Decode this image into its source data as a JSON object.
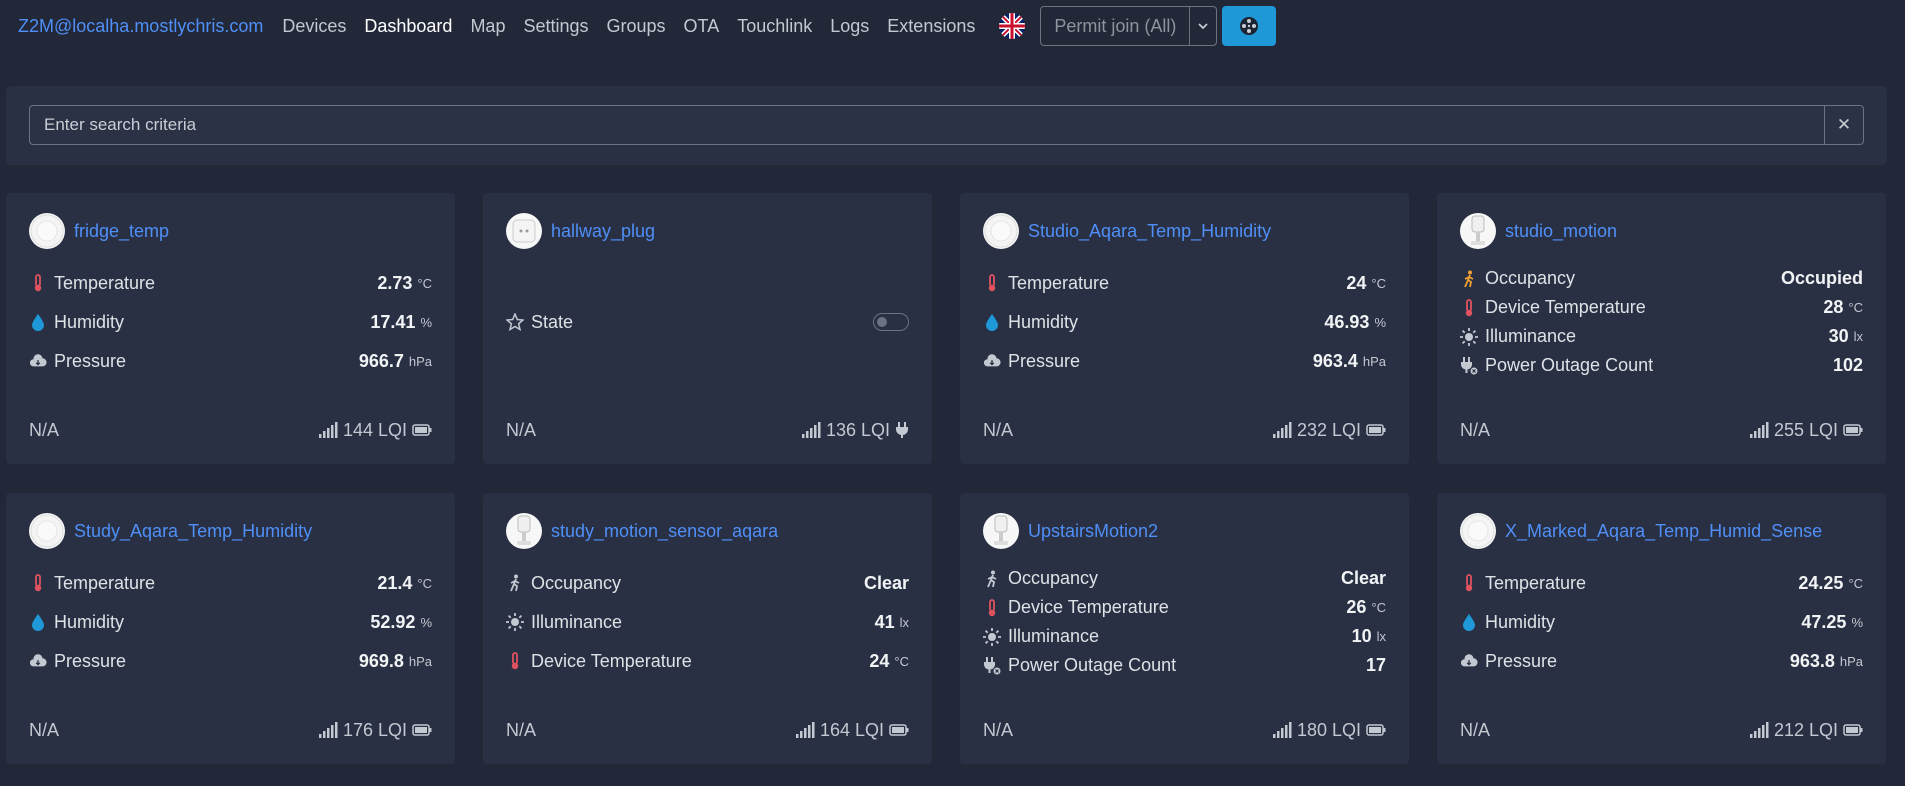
{
  "navbar": {
    "brand": "Z2M@localha.mostlychris.com",
    "links": [
      "Devices",
      "Dashboard",
      "Map",
      "Settings",
      "Groups",
      "OTA",
      "Touchlink",
      "Logs",
      "Extensions"
    ],
    "active": "Dashboard",
    "permit_join": "Permit join (All)"
  },
  "search": {
    "placeholder": "Enter search criteria",
    "clear": "✕"
  },
  "colors": {
    "accent": "#4f8ff7",
    "background": "#222838",
    "card": "#293043",
    "primary_button": "#1f98d8",
    "temperature_icon": "#e05260",
    "humidity_icon": "#1f98d8",
    "occupancy_icon": "#f0a030"
  },
  "devices": [
    {
      "name": "fridge_temp",
      "avatar": "round-sensor",
      "rows": [
        {
          "icon": "thermometer-icon",
          "label": "Temperature",
          "value": "2.73",
          "unit": "°C"
        },
        {
          "icon": "droplet-icon",
          "label": "Humidity",
          "value": "17.41",
          "unit": "%"
        },
        {
          "icon": "cloud-icon",
          "label": "Pressure",
          "value": "966.7",
          "unit": "hPa"
        }
      ],
      "footer": {
        "last_seen": "N/A",
        "lqi": "144 LQI",
        "power": "battery"
      }
    },
    {
      "name": "hallway_plug",
      "avatar": "plug",
      "rows": [
        {
          "icon": "star-icon",
          "label": "State",
          "value": "",
          "unit": "",
          "toggle": true
        }
      ],
      "footer": {
        "last_seen": "N/A",
        "lqi": "136 LQI",
        "power": "mains"
      }
    },
    {
      "name": "Studio_Aqara_Temp_Humidity",
      "avatar": "round-sensor",
      "rows": [
        {
          "icon": "thermometer-icon",
          "label": "Temperature",
          "value": "24",
          "unit": "°C"
        },
        {
          "icon": "droplet-icon",
          "label": "Humidity",
          "value": "46.93",
          "unit": "%"
        },
        {
          "icon": "cloud-icon",
          "label": "Pressure",
          "value": "963.4",
          "unit": "hPa"
        }
      ],
      "footer": {
        "last_seen": "N/A",
        "lqi": "232 LQI",
        "power": "battery"
      }
    },
    {
      "name": "studio_motion",
      "avatar": "motion-sensor",
      "rows": [
        {
          "icon": "walking-icon",
          "label": "Occupancy",
          "value": "Occupied",
          "unit": ""
        },
        {
          "icon": "thermometer-icon",
          "label": "Device Temperature",
          "value": "28",
          "unit": "°C"
        },
        {
          "icon": "sun-icon",
          "label": "Illuminance",
          "value": "30",
          "unit": "lx"
        },
        {
          "icon": "plug-off-icon",
          "label": "Power Outage Count",
          "value": "102",
          "unit": ""
        }
      ],
      "footer": {
        "last_seen": "N/A",
        "lqi": "255 LQI",
        "power": "battery"
      }
    },
    {
      "name": "Study_Aqara_Temp_Humidity",
      "avatar": "round-sensor",
      "rows": [
        {
          "icon": "thermometer-icon",
          "label": "Temperature",
          "value": "21.4",
          "unit": "°C"
        },
        {
          "icon": "droplet-icon",
          "label": "Humidity",
          "value": "52.92",
          "unit": "%"
        },
        {
          "icon": "cloud-icon",
          "label": "Pressure",
          "value": "969.8",
          "unit": "hPa"
        }
      ],
      "footer": {
        "last_seen": "N/A",
        "lqi": "176 LQI",
        "power": "battery"
      }
    },
    {
      "name": "study_motion_sensor_aqara",
      "avatar": "motion-sensor",
      "rows": [
        {
          "icon": "walking-icon",
          "label": "Occupancy",
          "value": "Clear",
          "unit": ""
        },
        {
          "icon": "sun-icon",
          "label": "Illuminance",
          "value": "41",
          "unit": "lx"
        },
        {
          "icon": "thermometer-icon",
          "label": "Device Temperature",
          "value": "24",
          "unit": "°C"
        }
      ],
      "footer": {
        "last_seen": "N/A",
        "lqi": "164 LQI",
        "power": "battery"
      }
    },
    {
      "name": "UpstairsMotion2",
      "avatar": "motion-sensor",
      "rows": [
        {
          "icon": "walking-icon",
          "label": "Occupancy",
          "value": "Clear",
          "unit": ""
        },
        {
          "icon": "thermometer-icon",
          "label": "Device Temperature",
          "value": "26",
          "unit": "°C"
        },
        {
          "icon": "sun-icon",
          "label": "Illuminance",
          "value": "10",
          "unit": "lx"
        },
        {
          "icon": "plug-off-icon",
          "label": "Power Outage Count",
          "value": "17",
          "unit": ""
        }
      ],
      "footer": {
        "last_seen": "N/A",
        "lqi": "180 LQI",
        "power": "battery"
      }
    },
    {
      "name": "X_Marked_Aqara_Temp_Humid_Sense",
      "avatar": "round-sensor",
      "rows": [
        {
          "icon": "thermometer-icon",
          "label": "Temperature",
          "value": "24.25",
          "unit": "°C"
        },
        {
          "icon": "droplet-icon",
          "label": "Humidity",
          "value": "47.25",
          "unit": "%"
        },
        {
          "icon": "cloud-icon",
          "label": "Pressure",
          "value": "963.8",
          "unit": "hPa"
        }
      ],
      "footer": {
        "last_seen": "N/A",
        "lqi": "212 LQI",
        "power": "battery"
      }
    }
  ]
}
